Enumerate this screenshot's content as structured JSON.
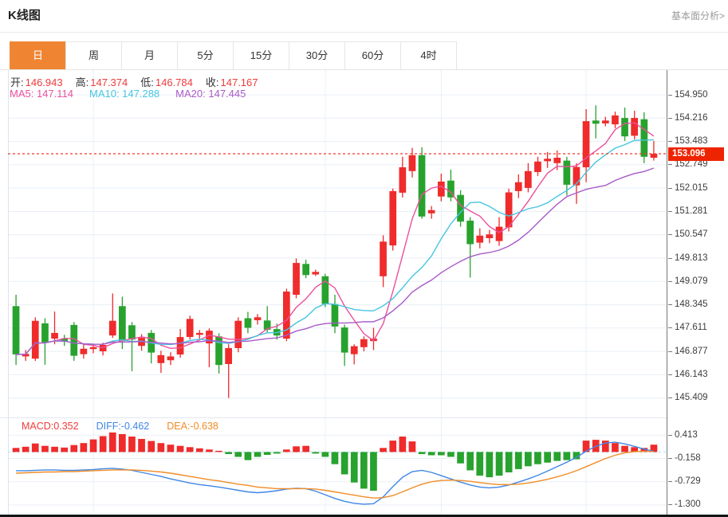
{
  "header": {
    "title": "K线图",
    "link": "基本面分析>"
  },
  "tabs": {
    "items": [
      "日",
      "周",
      "月",
      "5分",
      "15分",
      "30分",
      "60分",
      "4时"
    ],
    "active": "日"
  },
  "ohlc": {
    "o_label": "开:",
    "o": "146.943",
    "h_label": "高:",
    "h": "147.374",
    "l_label": "低:",
    "l": "146.784",
    "c_label": "收:",
    "c": "147.167"
  },
  "ma": {
    "ma5": "MA5: 147.114",
    "ma10": "MA10: 147.288",
    "ma20": "MA20: 147.445"
  },
  "macd_panel": {
    "macd": "MACD:0.352",
    "diff": "DIFF:-0.462",
    "dea": "DEA:-0.638"
  },
  "colors": {
    "accent_orange": "#ef8533",
    "up_red": "#ef2b2b",
    "down_green": "#28a22e",
    "ma5_pink": "#ec4f9d",
    "ma10_cyan": "#45c5e2",
    "ma20_purple": "#a85ac8",
    "diff_blue": "#3f87e5",
    "dea_orange": "#f08c26",
    "value_red": "#ef3b3b",
    "price_line_red": "#f03b2f",
    "badge_red": "#ee2400",
    "link_gray": "#999999",
    "grid": "#e9eff7",
    "border": "#e5e5e5",
    "axis_line": "#777777",
    "left_border": "#dde4ed",
    "axis_text": "#3c3c3c",
    "zero_dash_cyan": "#a8dcec"
  },
  "chart_data": {
    "type": "candlestick+macd",
    "title": "K线图",
    "legend": [
      "MA5",
      "MA10",
      "MA20",
      "MACD",
      "DIFF",
      "DEA"
    ],
    "price_ticks": [
      "154.950",
      "154.216",
      "153.483",
      "152.749",
      "152.015",
      "151.281",
      "150.547",
      "149.813",
      "149.079",
      "148.345",
      "147.611",
      "146.877",
      "146.143",
      "145.409"
    ],
    "current_price": "153.096",
    "current_price_value": 153.096,
    "macd_ticks": [
      "0.413",
      "-0.158",
      "-0.729",
      "-1.300"
    ],
    "ylim": [
      144.8,
      155.727
    ],
    "macd_ylim": [
      -1.537,
      0.849
    ],
    "grid_candle_indices": [
      8,
      32,
      44,
      59
    ],
    "ma_periods": [
      5,
      10,
      20
    ],
    "candles": [
      [
        148.3,
        148.66,
        146.45,
        146.78
      ],
      [
        146.72,
        146.92,
        146.58,
        146.8
      ],
      [
        146.65,
        147.95,
        146.58,
        147.84
      ],
      [
        147.76,
        147.92,
        146.46,
        147.16
      ],
      [
        147.28,
        148.13,
        147.1,
        147.46
      ],
      [
        147.28,
        147.4,
        147.05,
        147.18
      ],
      [
        147.71,
        147.8,
        146.58,
        146.74
      ],
      [
        146.79,
        147.1,
        146.65,
        146.96
      ],
      [
        146.95,
        147.12,
        146.82,
        147.01
      ],
      [
        146.88,
        147.15,
        146.75,
        147.08
      ],
      [
        147.38,
        148.7,
        147.3,
        147.84
      ],
      [
        148.3,
        148.6,
        146.95,
        147.2
      ],
      [
        147.7,
        147.8,
        146.25,
        147.25
      ],
      [
        147.05,
        147.42,
        146.9,
        147.3
      ],
      [
        147.46,
        147.55,
        146.5,
        146.84
      ],
      [
        146.51,
        146.9,
        146.2,
        146.76
      ],
      [
        146.6,
        146.85,
        146.45,
        146.72
      ],
      [
        146.78,
        147.58,
        146.68,
        147.33
      ],
      [
        147.33,
        148.0,
        147.25,
        147.9
      ],
      [
        147.4,
        147.55,
        147.28,
        147.46
      ],
      [
        147.13,
        147.6,
        146.38,
        147.53
      ],
      [
        147.35,
        147.45,
        146.18,
        146.45
      ],
      [
        146.48,
        147.1,
        145.41,
        146.98
      ],
      [
        146.98,
        147.95,
        146.85,
        147.84
      ],
      [
        147.92,
        148.12,
        147.45,
        147.62
      ],
      [
        147.86,
        148.05,
        147.72,
        147.95
      ],
      [
        147.85,
        148.3,
        147.45,
        147.56
      ],
      [
        147.58,
        147.75,
        147.25,
        147.38
      ],
      [
        147.28,
        148.85,
        147.2,
        148.76
      ],
      [
        148.66,
        149.8,
        148.55,
        149.66
      ],
      [
        149.63,
        149.76,
        149.18,
        149.28
      ],
      [
        149.3,
        149.45,
        149.25,
        149.38
      ],
      [
        149.24,
        149.32,
        148.27,
        148.37
      ],
      [
        148.37,
        148.66,
        147.45,
        147.66
      ],
      [
        147.63,
        147.72,
        146.42,
        146.84
      ],
      [
        146.79,
        147.1,
        146.47,
        147.04
      ],
      [
        147.01,
        147.35,
        146.88,
        147.26
      ],
      [
        147.2,
        147.62,
        146.92,
        147.28
      ],
      [
        149.24,
        150.53,
        148.9,
        150.33
      ],
      [
        150.21,
        152.0,
        150.05,
        151.92
      ],
      [
        151.87,
        153.0,
        151.72,
        152.67
      ],
      [
        152.55,
        153.28,
        152.35,
        153.05
      ],
      [
        153.05,
        153.3,
        151.05,
        151.12
      ],
      [
        151.22,
        151.45,
        151.05,
        151.32
      ],
      [
        151.75,
        152.47,
        151.6,
        152.22
      ],
      [
        152.25,
        152.6,
        151.6,
        151.72
      ],
      [
        151.8,
        151.95,
        150.8,
        150.96
      ],
      [
        150.99,
        151.1,
        149.2,
        150.25
      ],
      [
        150.3,
        150.75,
        150.12,
        150.52
      ],
      [
        150.44,
        150.7,
        150.28,
        150.56
      ],
      [
        150.35,
        151.1,
        150.2,
        150.8
      ],
      [
        150.78,
        152.0,
        150.65,
        151.88
      ],
      [
        151.92,
        152.45,
        151.7,
        152.2
      ],
      [
        152.02,
        152.8,
        151.88,
        152.55
      ],
      [
        152.52,
        153.0,
        152.4,
        152.85
      ],
      [
        152.86,
        153.15,
        152.65,
        152.94
      ],
      [
        152.8,
        153.2,
        152.58,
        152.97
      ],
      [
        152.88,
        153.0,
        151.78,
        152.12
      ],
      [
        152.1,
        152.8,
        151.52,
        152.68
      ],
      [
        152.67,
        154.5,
        152.2,
        154.12
      ],
      [
        154.14,
        154.62,
        153.58,
        154.04
      ],
      [
        154.05,
        154.26,
        153.96,
        154.14
      ],
      [
        154.02,
        154.42,
        153.9,
        154.3
      ],
      [
        154.22,
        154.55,
        153.5,
        153.64
      ],
      [
        153.66,
        154.45,
        153.55,
        154.22
      ],
      [
        154.18,
        154.4,
        152.8,
        153.0
      ],
      [
        152.97,
        153.5,
        152.88,
        153.096
      ]
    ],
    "macd_hist": [
      0.1,
      0.13,
      0.21,
      0.15,
      0.13,
      0.11,
      0.17,
      0.22,
      0.31,
      0.39,
      0.48,
      0.44,
      0.38,
      0.32,
      0.27,
      0.22,
      0.18,
      0.15,
      0.12,
      0.09,
      0.06,
      0.03,
      -0.05,
      -0.12,
      -0.2,
      -0.12,
      -0.07,
      -0.04,
      0.06,
      0.14,
      0.15,
      -0.04,
      -0.12,
      -0.3,
      -0.55,
      -0.75,
      -0.9,
      -0.95,
      0.1,
      0.28,
      0.38,
      0.26,
      -0.05,
      -0.08,
      -0.08,
      -0.12,
      -0.28,
      -0.45,
      -0.58,
      -0.62,
      -0.58,
      -0.5,
      -0.42,
      -0.35,
      -0.3,
      -0.26,
      -0.22,
      -0.2,
      -0.18,
      0.28,
      0.3,
      0.28,
      0.22,
      0.15,
      0.12,
      0.1,
      0.18
    ],
    "diff": [
      -0.46,
      -0.46,
      -0.45,
      -0.44,
      -0.44,
      -0.45,
      -0.45,
      -0.44,
      -0.43,
      -0.41,
      -0.4,
      -0.42,
      -0.45,
      -0.5,
      -0.55,
      -0.6,
      -0.66,
      -0.71,
      -0.76,
      -0.8,
      -0.83,
      -0.86,
      -0.9,
      -0.94,
      -0.98,
      -1.0,
      -0.98,
      -0.95,
      -0.91,
      -0.89,
      -0.9,
      -0.96,
      -1.05,
      -1.14,
      -1.21,
      -1.26,
      -1.28,
      -1.27,
      -1.1,
      -0.85,
      -0.62,
      -0.48,
      -0.45,
      -0.5,
      -0.58,
      -0.66,
      -0.74,
      -0.81,
      -0.86,
      -0.88,
      -0.86,
      -0.81,
      -0.74,
      -0.66,
      -0.57,
      -0.47,
      -0.36,
      -0.25,
      -0.13,
      0.02,
      0.14,
      0.22,
      0.24,
      0.2,
      0.14,
      0.07,
      0.02
    ],
    "dea": [
      -0.52,
      -0.51,
      -0.5,
      -0.49,
      -0.49,
      -0.48,
      -0.48,
      -0.47,
      -0.46,
      -0.45,
      -0.44,
      -0.44,
      -0.44,
      -0.45,
      -0.47,
      -0.49,
      -0.52,
      -0.56,
      -0.6,
      -0.64,
      -0.68,
      -0.71,
      -0.75,
      -0.79,
      -0.82,
      -0.86,
      -0.88,
      -0.9,
      -0.9,
      -0.9,
      -0.9,
      -0.91,
      -0.94,
      -0.98,
      -1.02,
      -1.06,
      -1.1,
      -1.13,
      -1.12,
      -1.07,
      -0.98,
      -0.88,
      -0.79,
      -0.73,
      -0.7,
      -0.69,
      -0.7,
      -0.72,
      -0.75,
      -0.78,
      -0.8,
      -0.8,
      -0.79,
      -0.76,
      -0.72,
      -0.67,
      -0.61,
      -0.54,
      -0.46,
      -0.36,
      -0.26,
      -0.16,
      -0.08,
      -0.02,
      0.01,
      0.02,
      0.01
    ]
  }
}
